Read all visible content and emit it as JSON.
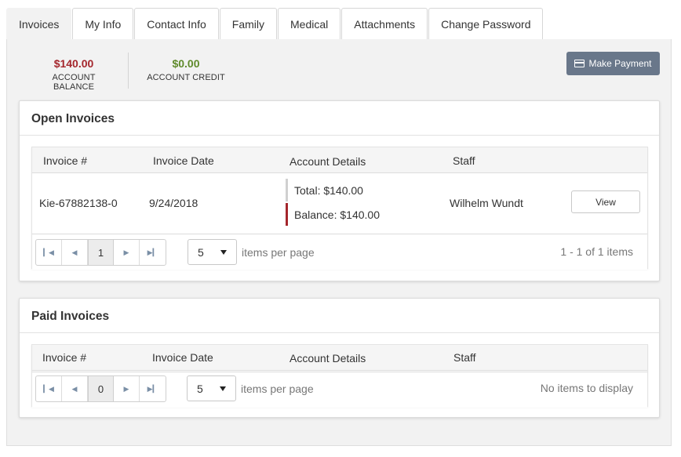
{
  "tabs": [
    {
      "label": "Invoices",
      "active": true
    },
    {
      "label": "My Info"
    },
    {
      "label": "Contact Info"
    },
    {
      "label": "Family"
    },
    {
      "label": "Medical"
    },
    {
      "label": "Attachments"
    },
    {
      "label": "Change Password"
    }
  ],
  "balance": {
    "amount": "$140.00",
    "label": "ACCOUNT BALANCE",
    "color": "#a4262c"
  },
  "credit": {
    "amount": "$0.00",
    "label": "ACCOUNT CREDIT",
    "color": "#5f8a2b"
  },
  "make_payment": {
    "label": "Make Payment",
    "icon": "credit-card-icon"
  },
  "open_invoices": {
    "title": "Open Invoices",
    "columns": [
      "Invoice #",
      "Invoice Date",
      "Account Details",
      "Staff"
    ],
    "rows": [
      {
        "invoice": "Kie-67882138-0",
        "date": "9/24/2018",
        "total": "Total: $140.00",
        "balance": "Balance: $140.00",
        "staff": "Wilhelm Wundt",
        "action": "View"
      }
    ],
    "pager": {
      "current_page": "1",
      "page_size": "5",
      "items_per_page": "items per page",
      "info": "1 - 1 of 1 items"
    }
  },
  "paid_invoices": {
    "title": "Paid Invoices",
    "columns": [
      "Invoice #",
      "Invoice Date",
      "Account Details",
      "Staff"
    ],
    "pager": {
      "current_page": "0",
      "page_size": "5",
      "items_per_page": "items per page",
      "info": "No items to display"
    }
  },
  "colors": {
    "accent": "#69778a",
    "balance_line": "#a4262c"
  }
}
